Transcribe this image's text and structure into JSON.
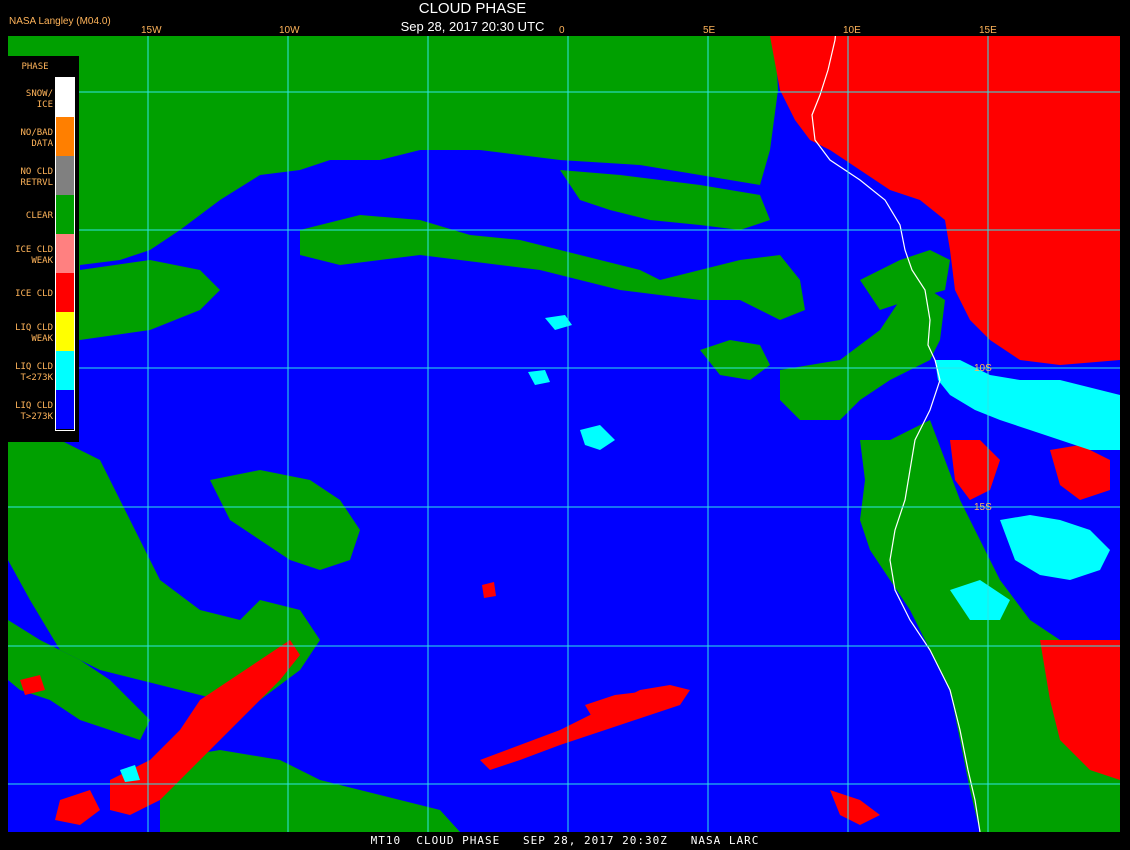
{
  "header": {
    "title": "CLOUD PHASE",
    "subtitle": "Sep 28, 2017 20:30 UTC",
    "source": "NASA Langley (M04.0)"
  },
  "footer": {
    "text": "MT10  CLOUD PHASE   SEP 28, 2017 20:30Z   NASA LARC"
  },
  "legend": {
    "heading": "PHASE",
    "items": [
      {
        "label": "SNOW/\nICE",
        "color": "#ffffff"
      },
      {
        "label": "NO/BAD\nDATA",
        "color": "#ff7f00"
      },
      {
        "label": "NO CLD\nRETRVL",
        "color": "#808080"
      },
      {
        "label": "CLEAR",
        "color": "#00a000"
      },
      {
        "label": "ICE CLD\nWEAK",
        "color": "#ff8080"
      },
      {
        "label": "ICE CLD",
        "color": "#ff0000"
      },
      {
        "label": "LIQ CLD\nWEAK",
        "color": "#ffff00"
      },
      {
        "label": "LIQ CLD\nT<273K",
        "color": "#00ffff"
      },
      {
        "label": "LIQ CLD\nT>273K",
        "color": "#0000ff"
      }
    ]
  },
  "grid": {
    "color": "#2ee6e6",
    "longitude_labels": [
      "15W",
      "10W",
      "0",
      "5E",
      "10E",
      "15E"
    ],
    "latitude_labels": [
      "10S",
      "15S"
    ]
  },
  "colors": {
    "ocean_liquid_cloud": "#0000ff",
    "clear": "#00a000",
    "ice_cloud": "#ff0000",
    "cold_liquid_cloud": "#00ffff",
    "coastline": "#ffffff",
    "label_color": "#ffb45a"
  }
}
